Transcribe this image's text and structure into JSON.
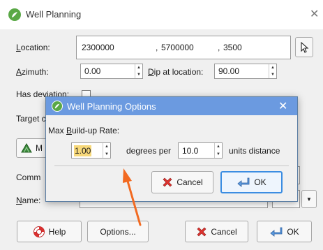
{
  "window": {
    "title": "Well Planning",
    "close_icon": "close-icon"
  },
  "form": {
    "location_label": "Location:",
    "location_x": "2300000",
    "location_sep1": ",",
    "location_y": "5700000",
    "location_sep2": ",",
    "location_z": "3500",
    "pick_icon": "pointer-icon",
    "azimuth_label": "Azimuth:",
    "azimuth_value": "0.00",
    "dip_label": "Dip at location:",
    "dip_value": "90.00",
    "has_deviation_label": "Has deviation:",
    "target_label": "Target c",
    "target_button_label": "M",
    "comments_label": "Comm",
    "name_label": "Name:"
  },
  "footer": {
    "help_label": "Help",
    "options_label": "Options...",
    "cancel_label": "Cancel",
    "ok_label": "OK"
  },
  "dialog": {
    "title": "Well Planning Options",
    "max_build_label": "Max Build-up Rate:",
    "rate_value": "1.00",
    "degrees_per_label": "degrees per",
    "distance_value": "10.0",
    "units_distance_label": "units distance",
    "cancel_label": "Cancel",
    "ok_label": "OK"
  },
  "annotation": {
    "arrow_color": "#f26a21"
  },
  "colors": {
    "dialog_title_bg": "#6b9ae0",
    "focus_blue": "#3b8de2",
    "highlight_yellow": "#f7d87a",
    "app_green": "#5aa846"
  }
}
